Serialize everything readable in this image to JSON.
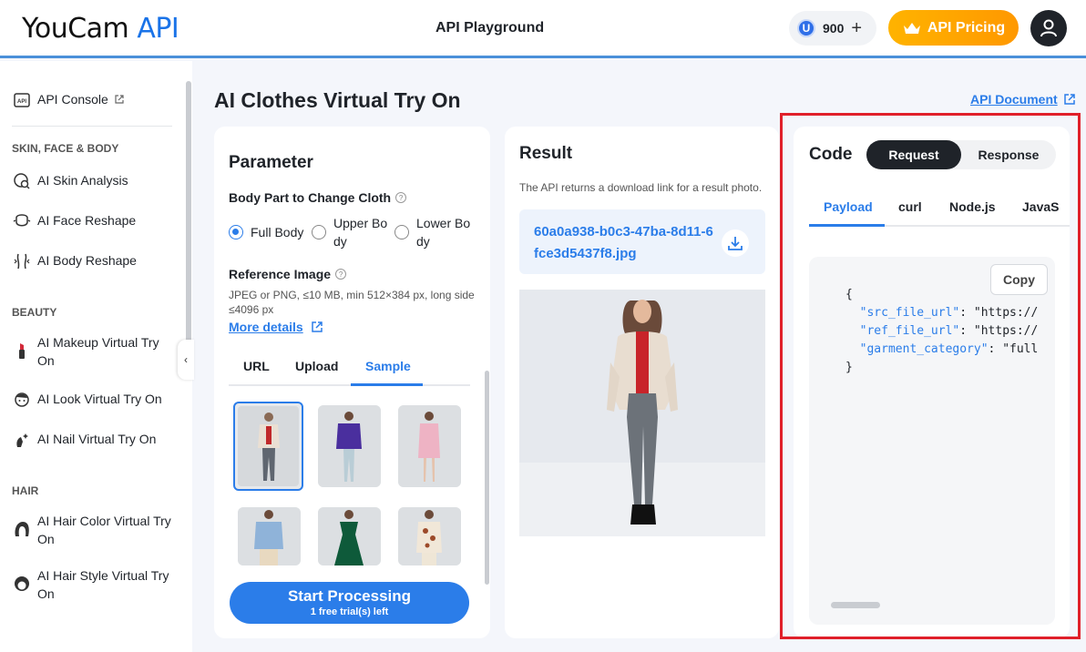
{
  "header": {
    "logo_brand": "YouCam",
    "logo_api": "API",
    "title": "API Playground",
    "credit_icon_letter": "U",
    "credits": "900",
    "credits_add": "+",
    "pricing_label": "API Pricing"
  },
  "sidebar": {
    "console": {
      "label": "API Console",
      "icon": "api-icon"
    },
    "sections": [
      {
        "title": "SKIN, FACE & BODY"
      },
      {
        "title": "BEAUTY"
      },
      {
        "title": "HAIR"
      }
    ],
    "items": [
      {
        "label": "AI Skin Analysis",
        "icon": "skin-analysis-icon"
      },
      {
        "label": "AI Face Reshape",
        "icon": "face-reshape-icon"
      },
      {
        "label": "AI Body Reshape",
        "icon": "body-reshape-icon"
      },
      {
        "label": "AI Makeup Virtual Try On",
        "icon": "lipstick-icon"
      },
      {
        "label": "AI Look Virtual Try On",
        "icon": "look-icon"
      },
      {
        "label": "AI Nail Virtual Try On",
        "icon": "nail-icon"
      },
      {
        "label": "AI Hair Color Virtual Try On",
        "icon": "hair-color-icon"
      },
      {
        "label": "AI Hair Style Virtual Try On",
        "icon": "hair-style-icon"
      }
    ]
  },
  "page": {
    "title": "AI Clothes Virtual Try On",
    "api_doc": "API Document"
  },
  "parameter": {
    "title": "Parameter",
    "body_part_label": "Body Part to Change Cloth",
    "options": [
      "Full Body",
      "Upper Bo\ndy",
      "Lower Bo\ndy"
    ],
    "selected": "Full Body",
    "reference_label": "Reference Image",
    "reference_desc": "JPEG or PNG, ≤10 MB, min 512×384 px, long side ≤4096 px",
    "more_details": "More details",
    "tabs": [
      "URL",
      "Upload",
      "Sample"
    ],
    "active_tab": "Sample",
    "start_label": "Start Processing",
    "trial_label": "1 free trial(s) left"
  },
  "result": {
    "title": "Result",
    "desc": "The API returns a download link for a result photo.",
    "file_link": "60a0a938-b0c3-47ba-8d11-6fce3d5437f8.jpg"
  },
  "code": {
    "title": "Code",
    "seg_request": "Request",
    "seg_response": "Response",
    "tabs": [
      "Payload",
      "curl",
      "Node.js",
      "JavaS"
    ],
    "active_tab": "Payload",
    "copy_label": "Copy",
    "open_brace": "{",
    "lines": [
      {
        "key": "\"src_file_url\"",
        "rest": ": \"https://"
      },
      {
        "key": "\"ref_file_url\"",
        "rest": ": \"https://"
      },
      {
        "key": "\"garment_category\"",
        "rest": ": \"full"
      }
    ],
    "close_brace": "}"
  }
}
